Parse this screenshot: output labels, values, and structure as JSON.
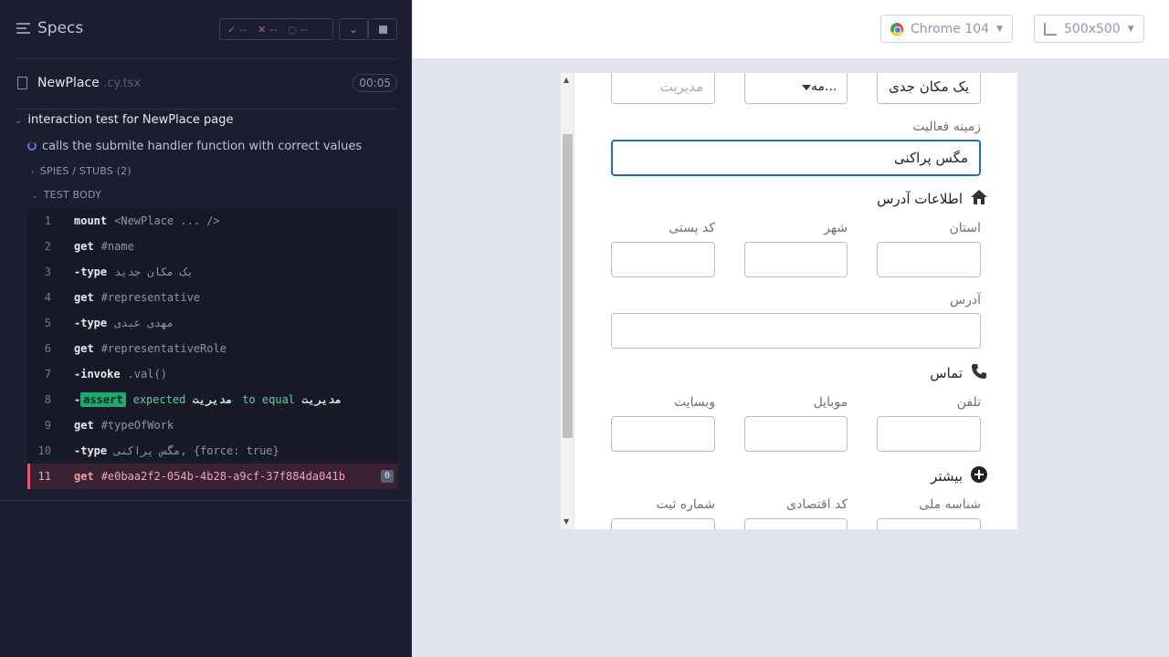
{
  "reporter": {
    "title": "Specs",
    "stats": {
      "passed": "--",
      "failed": "--",
      "pending": "--"
    },
    "spec_file": {
      "name": "NewPlace",
      "ext": ".cy.tsx",
      "duration": "00:05"
    },
    "suite_title": "interaction test for NewPlace page",
    "test_title": "calls the submite handler function with correct values",
    "spies_label": "SPIES / STUBS (2)",
    "body_label": "TEST BODY",
    "commands": [
      {
        "num": "1",
        "name": "mount",
        "msg": "<NewPlace ... />"
      },
      {
        "num": "2",
        "name": "get",
        "msg": "#name"
      },
      {
        "num": "3",
        "name": "-type",
        "msg": "یک مکان جدید"
      },
      {
        "num": "4",
        "name": "get",
        "msg": "#representative"
      },
      {
        "num": "5",
        "name": "-type",
        "msg": "مهدی عبدی"
      },
      {
        "num": "6",
        "name": "get",
        "msg": "#representativeRole"
      },
      {
        "num": "7",
        "name": "-invoke",
        "msg": ".val()"
      },
      {
        "num": "8",
        "prefix": "-",
        "badge": "assert",
        "t1": "expected",
        "v1": "مدیریت",
        "t2": "to equal",
        "v2": "مدیریت"
      },
      {
        "num": "9",
        "name": "get",
        "msg": "#typeOfWork"
      },
      {
        "num": "10",
        "name": "-type",
        "msg": "مگس پراکنی, {force: true}"
      },
      {
        "num": "11",
        "name": "get",
        "msg": "#e0baa2f2-054b-4b28-a9cf-37f884da041b",
        "count": "0"
      }
    ]
  },
  "topbar": {
    "browser": "Chrome 104",
    "viewport": "500x500"
  },
  "form": {
    "name_value": "یک مکان جدی",
    "role_selected": "مه...",
    "role_placeholder": "مدیریت",
    "type_of_work_label": "زمینه فعالیت",
    "type_of_work_value": "مگس پراکنی",
    "address_section": "اطلاعات آدرس",
    "province_label": "استان",
    "city_label": "شهر",
    "postal_label": "کد پستی",
    "address_label": "آدرس",
    "contact_section": "تماس",
    "phone_label": "تلفن",
    "mobile_label": "موبایل",
    "website_label": "وبسایت",
    "more_section": "بیشتر",
    "national_id_label": "شناسه ملی",
    "economic_code_label": "کد اقتصادی",
    "registration_label": "شماره ثبت"
  }
}
